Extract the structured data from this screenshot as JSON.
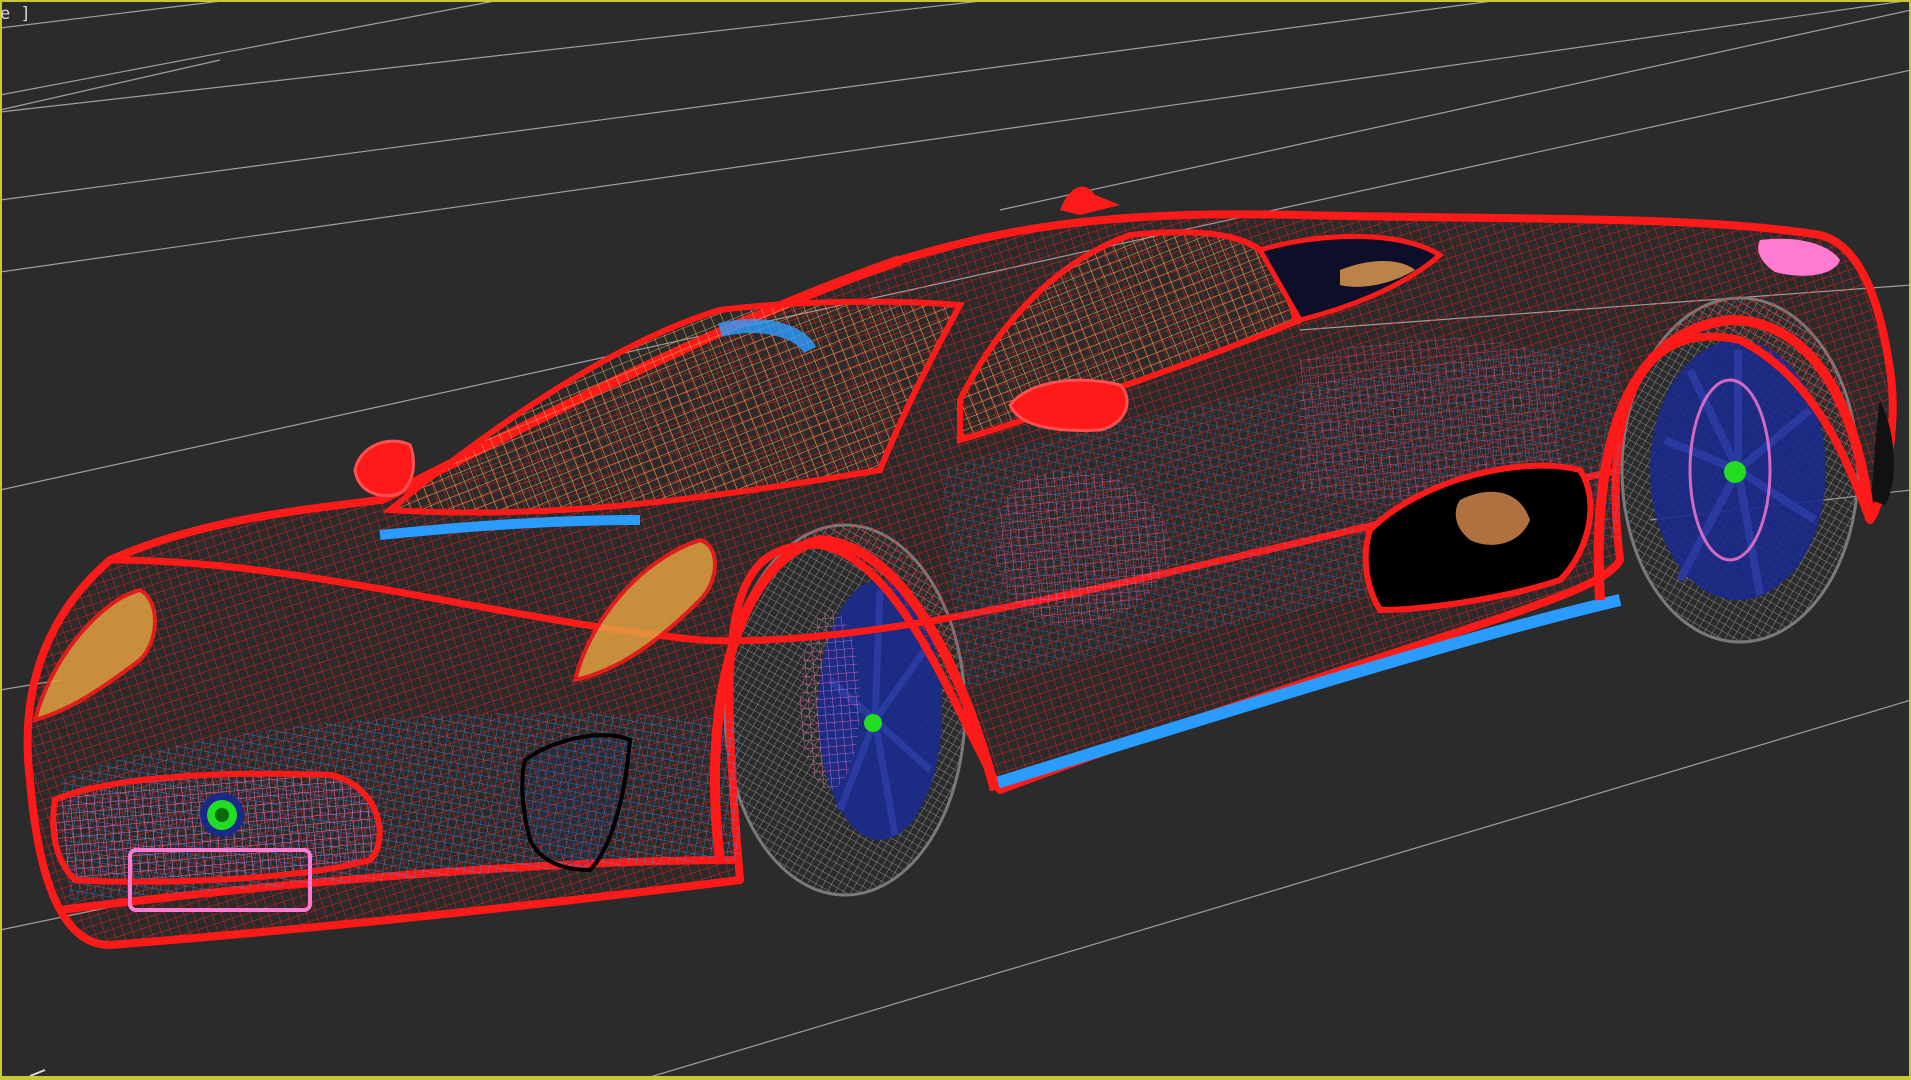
{
  "viewport": {
    "label": "e ]",
    "shading_mode": "wireframe",
    "border_color": "#c8c832",
    "background_color": "#2b2b2b",
    "grid_color": "#c8c8c8"
  },
  "model": {
    "body_wire_color": "#ff1a1a",
    "glass_wire_color": "#e8a050",
    "interior_wire_color": "#2a9cff",
    "detail_wire_color": "#ff7ad0",
    "tire_wire_color": "#8a8a8a",
    "rim_color": "#1a2a8a",
    "hub_color": "#22dd22",
    "headlight_color": "#e0a040"
  }
}
